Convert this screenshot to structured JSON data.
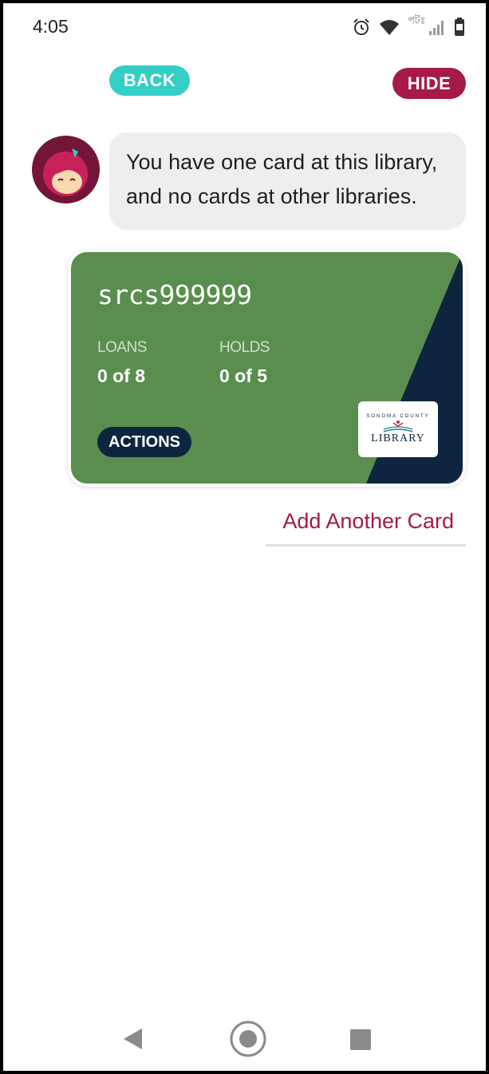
{
  "status_bar": {
    "time": "4:05",
    "carrier": "পটঃ"
  },
  "header": {
    "back_label": "BACK",
    "hide_label": "HIDE"
  },
  "message": {
    "line1": "You have one card at this library,",
    "line2": "and no cards at other libraries."
  },
  "card": {
    "number": "srcs999999",
    "loans_label": "LOANS",
    "loans_value": "0 of 8",
    "holds_label": "HOLDS",
    "holds_value": "0 of 5",
    "actions_label": "ACTIONS",
    "logo_top": "SONOMA COUNTY",
    "logo_main": "LIBRARY",
    "colors": {
      "card_green": "#5a8e4f",
      "card_navy": "#0e2540"
    }
  },
  "add_card_label": "Add Another Card",
  "colors": {
    "back_button": "#33cfc5",
    "hide_button": "#a6194a",
    "link": "#a6194a"
  },
  "nav": {
    "back_icon": "triangle-back-icon",
    "home_icon": "circle-home-icon",
    "recent_icon": "square-recents-icon"
  }
}
